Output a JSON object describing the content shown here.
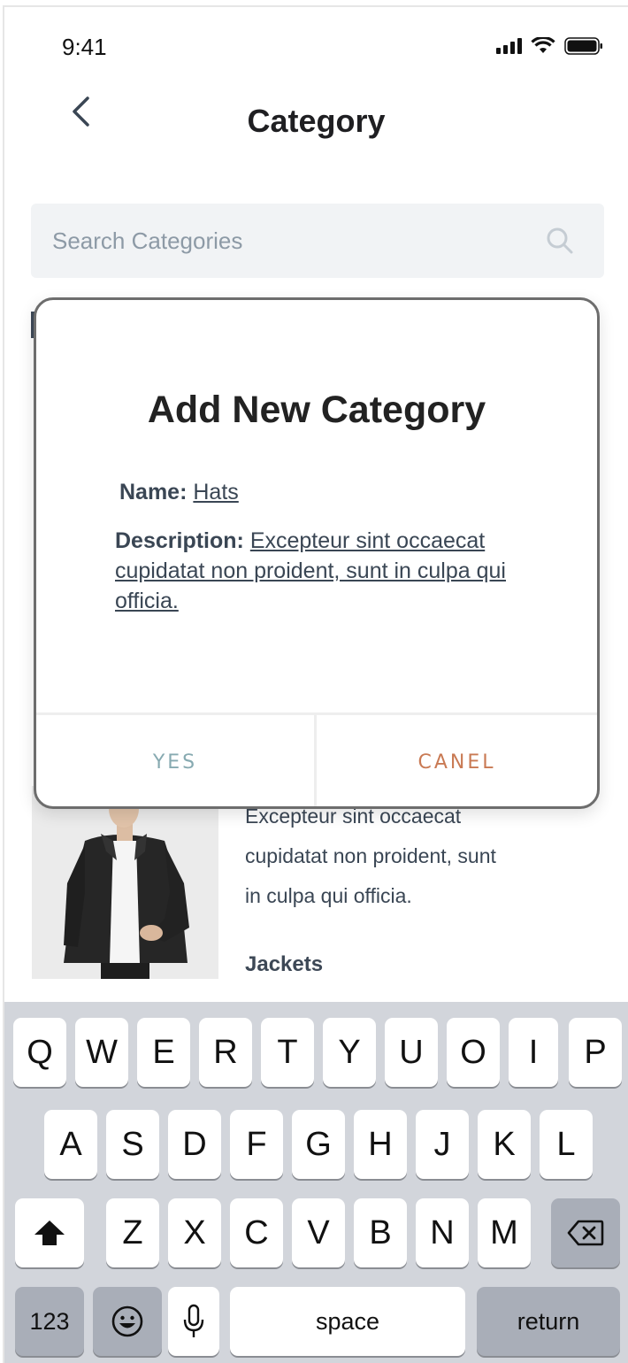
{
  "status_bar": {
    "time": "9:41"
  },
  "header": {
    "title": "Category"
  },
  "search": {
    "placeholder": "Search Categories"
  },
  "background_list": {
    "description_partial": "Excepteur sint occaecat",
    "description_lines": [
      "cupidatat non proident, sunt",
      "in culpa qui officia."
    ],
    "next_item_name": "Jackets"
  },
  "modal": {
    "title": "Add New Category",
    "name_label": "Name:",
    "name_value": "Hats",
    "description_label": "Description:",
    "description_value": "Excepteur sint occaecat cupidatat non proident, sunt in culpa qui officia.",
    "yes_label": "YES",
    "cancel_label": "CANEL"
  },
  "keyboard": {
    "row1": [
      "Q",
      "W",
      "E",
      "R",
      "T",
      "Y",
      "U",
      "O",
      "I",
      "P"
    ],
    "row2": [
      "A",
      "S",
      "D",
      "F",
      "G",
      "H",
      "J",
      "K",
      "L"
    ],
    "row3": [
      "Z",
      "X",
      "C",
      "V",
      "B",
      "N",
      "M"
    ],
    "numbers_label": "123",
    "space_label": "space",
    "return_label": "return"
  },
  "colors": {
    "yes_button": "#87aab1",
    "cancel_button": "#c97a54",
    "text_slate": "#3a4654",
    "keyboard_bg": "#d2d5db"
  }
}
